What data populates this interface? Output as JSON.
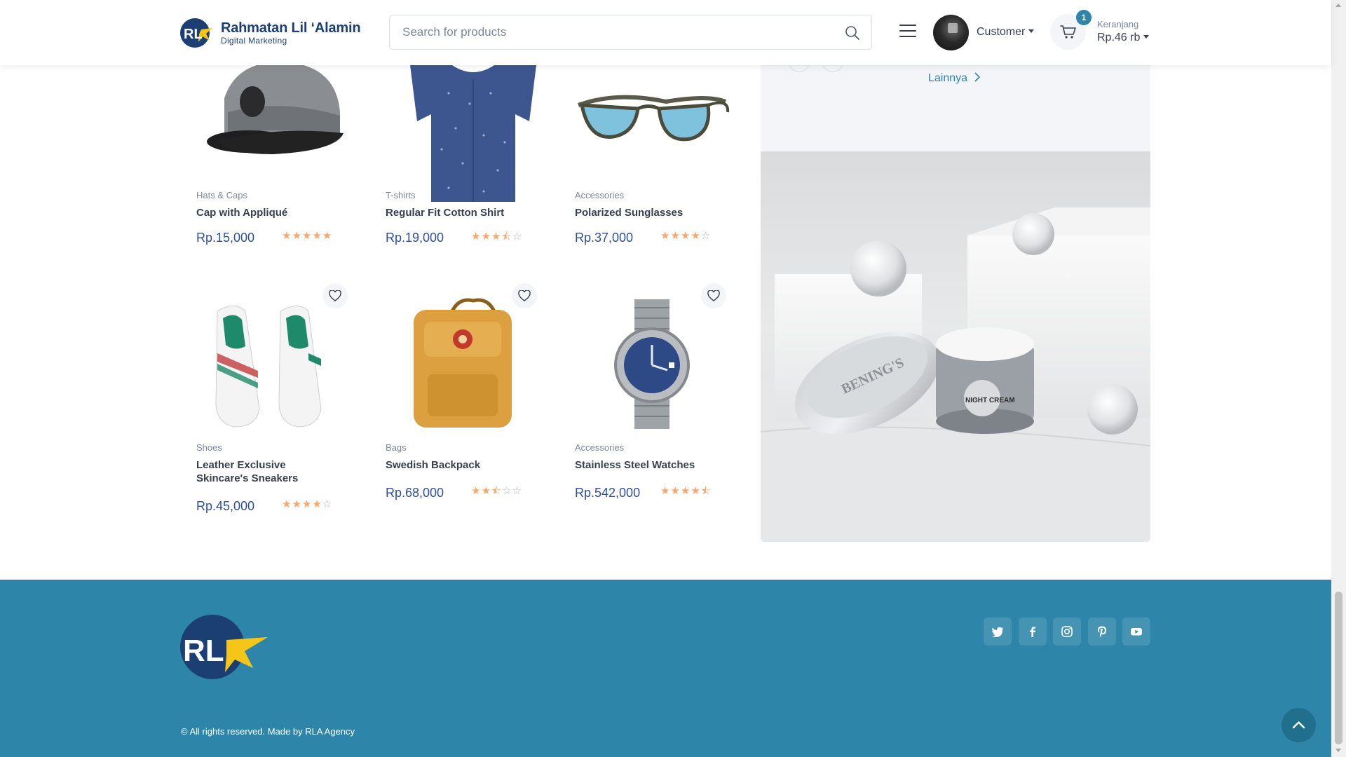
{
  "header": {
    "brand_name": "Rahmatan Lil ‘Alamin",
    "brand_tagline": "Digital Marketing",
    "search_placeholder": "Search for products",
    "user_label": "Customer",
    "cart_count": "1",
    "cart_label": "Keranjang",
    "cart_total": "Rp.46 rb"
  },
  "products": [
    {
      "category": "Hats & Caps",
      "name": "Cap with Appliqué",
      "price": "Rp.15,000",
      "rating": 5
    },
    {
      "category": "T-shirts",
      "name": "Regular Fit Cotton Shirt",
      "price": "Rp.19,000",
      "rating": 3.5
    },
    {
      "category": "Accessories",
      "name": "Polarized Sunglasses",
      "price": "Rp.37,000",
      "rating": 4
    },
    {
      "category": "Shoes",
      "name": "Leather Exclusive Skincare's Sneakers",
      "price": "Rp.45,000",
      "rating": 4
    },
    {
      "category": "Bags",
      "name": "Swedish Backpack",
      "price": "Rp.68,000",
      "rating": 2.5
    },
    {
      "category": "Accessories",
      "name": "Stainless Steel Watches",
      "price": "Rp.542,000",
      "rating": 4.5
    }
  ],
  "promo": {
    "link_label": "Lainnya",
    "cream_brand": "BENING'S",
    "cream_label": "NIGHT CREAM"
  },
  "footer": {
    "logo_text": "RL",
    "social": [
      "twitter-icon",
      "facebook-icon",
      "instagram-icon",
      "pinterest-icon",
      "youtube-icon"
    ],
    "copyright": "© All rights reserved. Made by RLA Agency"
  },
  "colors": {
    "accent": "#2d86a9",
    "price": "#2d4f9c",
    "star": "#fea569",
    "brand": "#1c3f73"
  }
}
